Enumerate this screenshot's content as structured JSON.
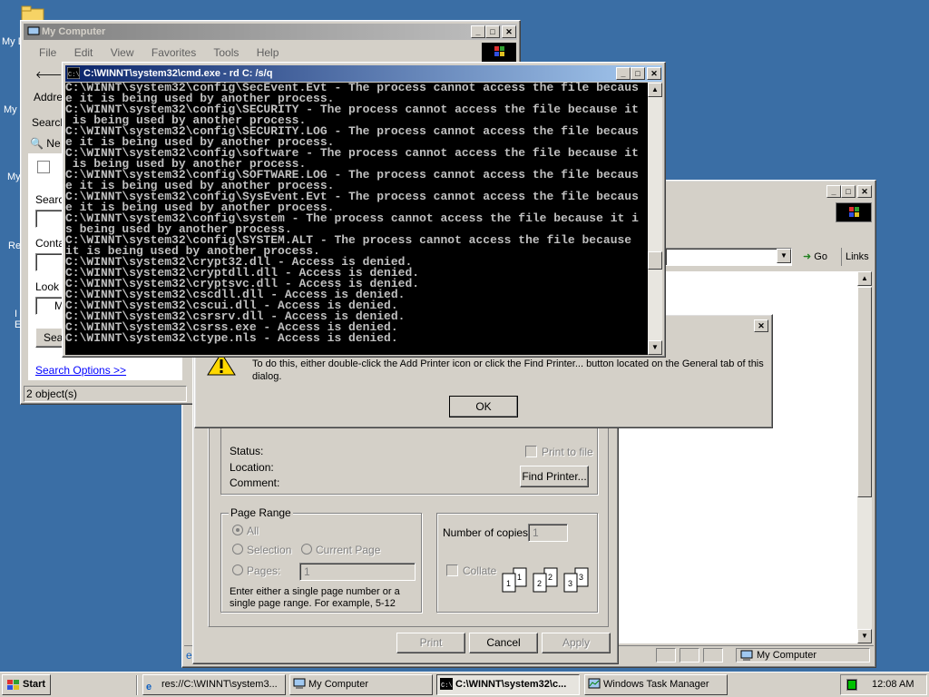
{
  "desktop": {
    "labels": [
      "My D",
      "My",
      "My",
      "Re",
      "I",
      "E"
    ]
  },
  "my_computer": {
    "title": "My Computer",
    "menu": [
      "File",
      "Edit",
      "View",
      "Favorites",
      "Tools",
      "Help"
    ],
    "back": "B",
    "address_label": "Addre",
    "search_button": "Search",
    "new_label": "Ne",
    "search_label": "Searc",
    "contains_label": "Conta",
    "look_label": "Look",
    "look_value": "M",
    "search_now": "Sea",
    "search_options": "Search Options >>",
    "status": "2 object(s)"
  },
  "cmd": {
    "title": "C:\\WINNT\\system32\\cmd.exe - rd C: /s/q",
    "lines": [
      "C:\\WINNT\\system32\\config\\SecEvent.Evt - The process cannot access the file becaus",
      "e it is being used by another process.",
      "C:\\WINNT\\system32\\config\\SECURITY - The process cannot access the file because it",
      " is being used by another process.",
      "C:\\WINNT\\system32\\config\\SECURITY.LOG - The process cannot access the file becaus",
      "e it is being used by another process.",
      "C:\\WINNT\\system32\\config\\software - The process cannot access the file because it",
      " is being used by another process.",
      "C:\\WINNT\\system32\\config\\SOFTWARE.LOG - The process cannot access the file becaus",
      "e it is being used by another process.",
      "C:\\WINNT\\system32\\config\\SysEvent.Evt - The process cannot access the file becaus",
      "e it is being used by another process.",
      "C:\\WINNT\\system32\\config\\system - The process cannot access the file because it i",
      "s being used by another process.",
      "C:\\WINNT\\system32\\config\\SYSTEM.ALT - The process cannot access the file because",
      "it is being used by another process.",
      "C:\\WINNT\\system32\\crypt32.dll - Access is denied.",
      "C:\\WINNT\\system32\\cryptdll.dll - Access is denied.",
      "C:\\WINNT\\system32\\cryptsvc.dll - Access is denied.",
      "C:\\WINNT\\system32\\cscdll.dll - Access is denied.",
      "C:\\WINNT\\system32\\cscui.dll - Access is denied.",
      "C:\\WINNT\\system32\\csrsrv.dll - Access is denied.",
      "C:\\WINNT\\system32\\csrss.exe - Access is denied.",
      "C:\\WINNT\\system32\\ctype.nls - Access is denied."
    ]
  },
  "browser": {
    "go": "Go",
    "links": "Links",
    "zone": "My Computer"
  },
  "message": {
    "text": "To do this, either double-click the Add Printer icon or click the Find Printer... button located on the General tab of this dialog.",
    "ok": "OK"
  },
  "print": {
    "status_label": "Status:",
    "location_label": "Location:",
    "comment_label": "Comment:",
    "print_to_file": "Print to file",
    "find_printer": "Find Printer...",
    "page_range_title": "Page Range",
    "all": "All",
    "selection": "Selection",
    "current_page": "Current Page",
    "pages": "Pages:",
    "pages_value": "1",
    "hint": "Enter either a single page number or a single page range.  For example, 5-12",
    "copies_label": "Number of copies:",
    "copies_value": "1",
    "collate": "Collate",
    "print_btn": "Print",
    "cancel_btn": "Cancel",
    "apply_btn": "Apply"
  },
  "taskbar": {
    "start": "Start",
    "tasks": [
      "res://C:\\WINNT\\system3...",
      "My Computer",
      "C:\\WINNT\\system32\\c...",
      "Windows Task Manager"
    ],
    "clock": "12:08 AM"
  },
  "colors": {
    "desktop": "#3a6ea5",
    "title_active": "#0a246a",
    "face": "#d4d0c8"
  }
}
